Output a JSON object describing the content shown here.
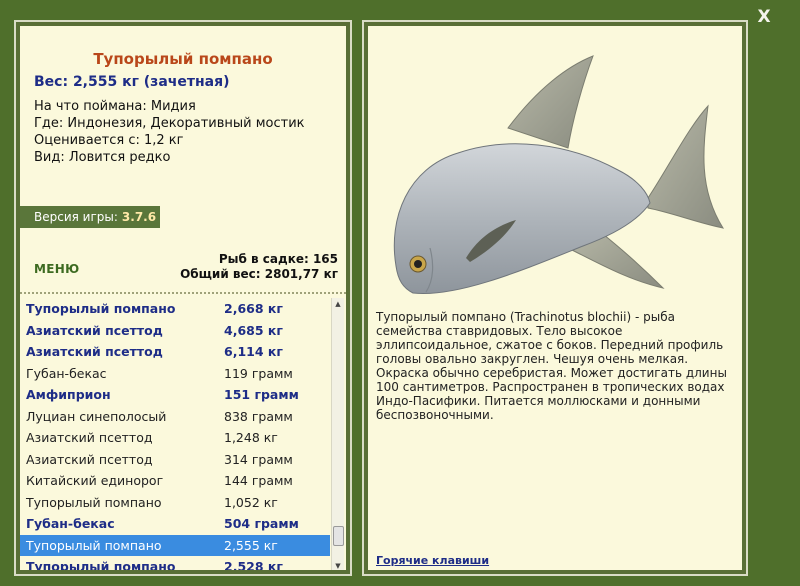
{
  "close_label": "X",
  "fish": {
    "title": "Тупорылый помпано",
    "weight_line": "Вес: 2,555 кг (зачетная)",
    "info": [
      "На что поймана: Мидия",
      "Где: Индонезия, Декоративный мостик",
      "Оценивается с: 1,2 кг",
      "Вид: Ловится редко"
    ],
    "description": "Тупорылый помпано (Trachinotus blochii) - рыба семейства ставридовых. Тело высокое эллипсоидальное, сжатое с боков. Передний профиль головы овально закруглен. Чешуя очень мелкая. Окраска обычно серебристая. Может достигать длины 100 сантиметров. Распространен в тропических водах Индо-Пасифики. Питается моллюсками и донными беспозвоночными."
  },
  "version": {
    "label": "Версия игры:",
    "number": "3.7.6"
  },
  "menu_label": "МЕНЮ",
  "stats": {
    "count_line": "Рыб в садке: 165",
    "total_line": "Общий вес: 2801,77 кг"
  },
  "list": [
    {
      "name": "Тупорылый помпано",
      "weight": "2,668 кг",
      "bold": true
    },
    {
      "name": "Азиатский псеттод",
      "weight": "4,685 кг",
      "bold": true
    },
    {
      "name": "Азиатский псеттод",
      "weight": "6,114 кг",
      "bold": true
    },
    {
      "name": "Губан-бекас",
      "weight": "119 грамм",
      "bold": false
    },
    {
      "name": "Амфиприон",
      "weight": "151 грамм",
      "bold": true
    },
    {
      "name": "Луциан синеполосый",
      "weight": "838 грамм",
      "bold": false
    },
    {
      "name": "Азиатский псеттод",
      "weight": "1,248 кг",
      "bold": false
    },
    {
      "name": "Азиатский псеттод",
      "weight": "314 грамм",
      "bold": false
    },
    {
      "name": "Китайский единорог",
      "weight": "144 грамм",
      "bold": false
    },
    {
      "name": "Тупорылый помпано",
      "weight": "1,052 кг",
      "bold": false
    },
    {
      "name": "Губан-бекас",
      "weight": "504 грамм",
      "bold": true
    },
    {
      "name": "Тупорылый помпано",
      "weight": "2,555 кг",
      "bold": false,
      "selected": true
    },
    {
      "name": "Тупорылый помпано",
      "weight": "2,528 кг",
      "bold": true
    }
  ],
  "scroll_arrows": {
    "up": "▲",
    "down": "▼"
  },
  "hotkeys_label": "Горячие клавиши",
  "colors": {
    "background": "#4f6f2b",
    "card": "#fbf9dc",
    "title": "#b9471a",
    "accent_blue": "#1e2d87",
    "selection": "#3a8ce0"
  }
}
